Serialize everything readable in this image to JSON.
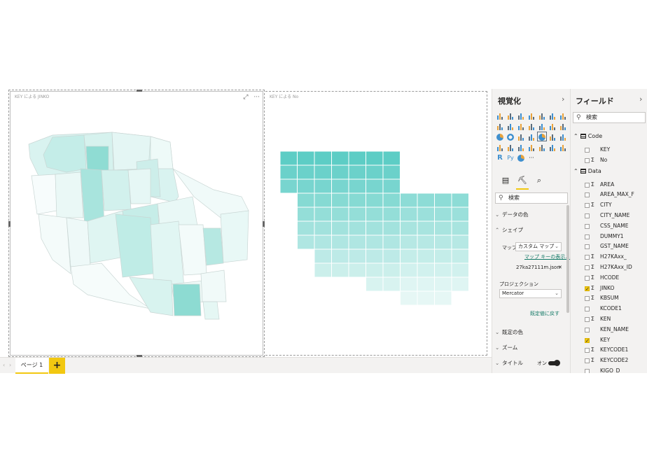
{
  "canvas": {
    "visual1_title": "KEY による JINKO",
    "visual2_title": "KEY による No",
    "focus_icon": "focus-mode-icon",
    "more_label": "···"
  },
  "tabs": {
    "prev": "‹",
    "next": "›",
    "pages": [
      {
        "label": "ページ 1",
        "active": true
      }
    ],
    "add_label": "+"
  },
  "visualizations": {
    "title": "視覚化",
    "chevron": "›",
    "more": "···",
    "search_placeholder": "検索",
    "sections": {
      "data_colors": "データの色",
      "shape": "シェイプ",
      "default_colors": "既定の色",
      "zoom": "ズーム",
      "title": "タイトル"
    },
    "map_label": "マップ",
    "map_value": "カスタム マップ",
    "map_key_link": "マップ キーの表示...",
    "file_name": "27ka27111m.json",
    "file_remove": "✕",
    "projection_label": "プロジェクション",
    "projection_value": "Mercator",
    "reset_link": "既定値に戻す",
    "title_toggle_label": "オン"
  },
  "fields": {
    "title": "フィールド",
    "chevron": "›",
    "search_placeholder": "検索",
    "tables": [
      {
        "name": "Code",
        "expanded": true,
        "fields": [
          {
            "name": "KEY",
            "sigma": false,
            "checked": false
          },
          {
            "name": "No",
            "sigma": true,
            "checked": false
          }
        ]
      },
      {
        "name": "Data",
        "expanded": true,
        "fields": [
          {
            "name": "AREA",
            "sigma": true,
            "checked": false
          },
          {
            "name": "AREA_MAX_F",
            "sigma": false,
            "checked": false
          },
          {
            "name": "CITY",
            "sigma": true,
            "checked": false
          },
          {
            "name": "CITY_NAME",
            "sigma": false,
            "checked": false
          },
          {
            "name": "CSS_NAME",
            "sigma": false,
            "checked": false
          },
          {
            "name": "DUMMY1",
            "sigma": false,
            "checked": false
          },
          {
            "name": "GST_NAME",
            "sigma": false,
            "checked": false
          },
          {
            "name": "H27KAxx_",
            "sigma": true,
            "checked": false
          },
          {
            "name": "H27KAxx_ID",
            "sigma": true,
            "checked": false
          },
          {
            "name": "HCODE",
            "sigma": true,
            "checked": false
          },
          {
            "name": "JINKO",
            "sigma": true,
            "checked": true
          },
          {
            "name": "KBSUM",
            "sigma": true,
            "checked": false
          },
          {
            "name": "KCODE1",
            "sigma": false,
            "checked": false
          },
          {
            "name": "KEN",
            "sigma": true,
            "checked": false
          },
          {
            "name": "KEN_NAME",
            "sigma": false,
            "checked": false
          },
          {
            "name": "KEY",
            "sigma": false,
            "checked": true
          },
          {
            "name": "KEYCODE1",
            "sigma": true,
            "checked": false
          },
          {
            "name": "KEYCODE2",
            "sigma": true,
            "checked": false
          },
          {
            "name": "KIGO_D",
            "sigma": false,
            "checked": false
          }
        ]
      }
    ]
  },
  "colors": {
    "accent": "#f2c811",
    "teal_dark": "#5dcdc5",
    "teal_light": "#e7f7f5"
  }
}
